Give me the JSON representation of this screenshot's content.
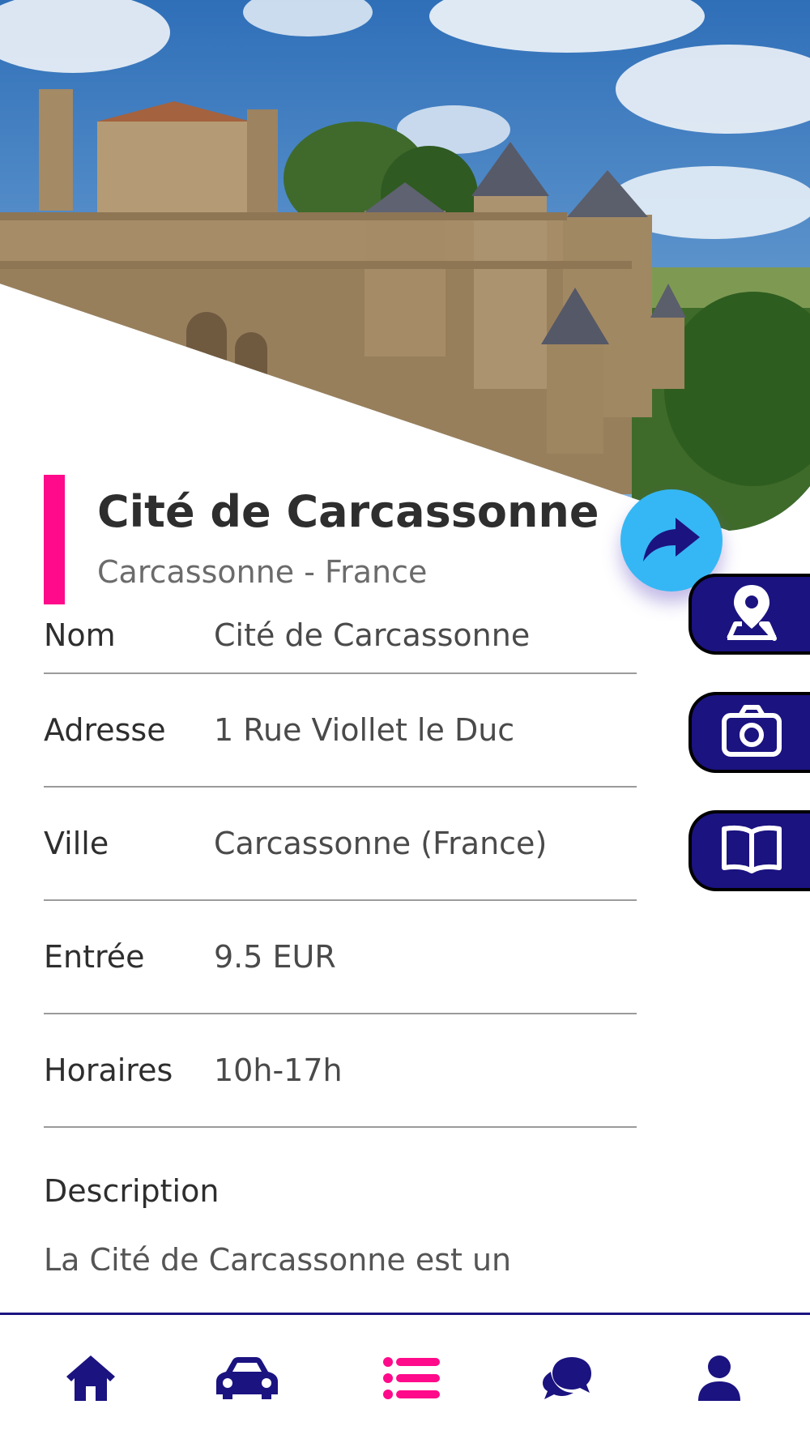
{
  "place": {
    "title": "Cité de Carcassonne",
    "subtitle": "Carcassonne - France"
  },
  "details": [
    {
      "label": "Nom",
      "value": "Cité de Carcassonne"
    },
    {
      "label": "Adresse",
      "value": "1 Rue Viollet le Duc"
    },
    {
      "label": "Ville",
      "value": "Carcassonne (France)"
    },
    {
      "label": "Entrée",
      "value": "9.5 EUR"
    },
    {
      "label": "Horaires",
      "value": "10h-17h"
    }
  ],
  "description": {
    "label": "Description",
    "text": "La Cité de Carcassonne est un"
  },
  "actions": {
    "share_icon": "share-arrow-icon",
    "side_tabs": [
      "map-pin-icon",
      "camera-icon",
      "book-icon"
    ]
  },
  "nav": {
    "items": [
      "home-icon",
      "car-icon",
      "list-icon",
      "chat-icon",
      "user-icon"
    ],
    "active": "list-icon"
  },
  "colors": {
    "accent": "#ff0a8a",
    "primary": "#1b1380",
    "share": "#35b7f5"
  }
}
